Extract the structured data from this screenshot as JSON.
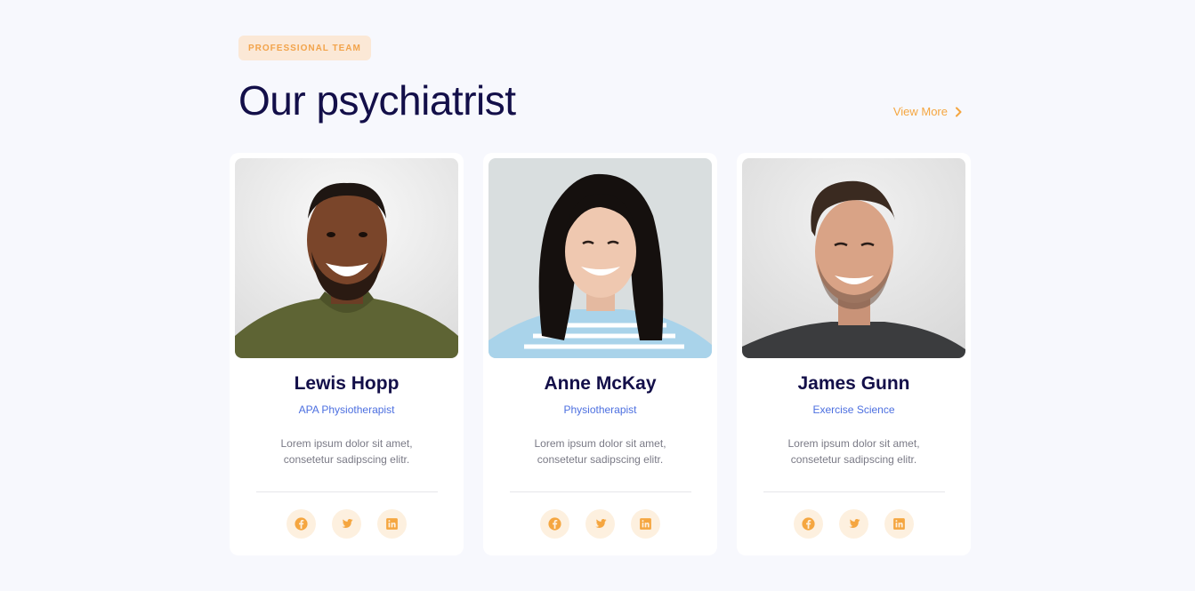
{
  "header": {
    "badge": "PROFESSIONAL TEAM",
    "title": "Our psychiatrist",
    "view_more": "View More"
  },
  "colors": {
    "accent": "#f5a640",
    "heading": "#130f49",
    "role": "#4c6fe0",
    "background": "#f7f8fd"
  },
  "team": [
    {
      "name": "Lewis Hopp",
      "role": "APA Physiotherapist",
      "description": "Lorem ipsum dolor sit amet, consetetur sadipscing elitr.",
      "socials": [
        "facebook-icon",
        "twitter-icon",
        "linkedin-icon"
      ]
    },
    {
      "name": "Anne McKay",
      "role": "Physiotherapist",
      "description": "Lorem ipsum dolor sit amet, consetetur sadipscing elitr.",
      "socials": [
        "facebook-icon",
        "twitter-icon",
        "linkedin-icon"
      ]
    },
    {
      "name": "James Gunn",
      "role": "Exercise Science",
      "description": "Lorem ipsum dolor sit amet, consetetur sadipscing elitr.",
      "socials": [
        "facebook-icon",
        "twitter-icon",
        "linkedin-icon"
      ]
    }
  ]
}
